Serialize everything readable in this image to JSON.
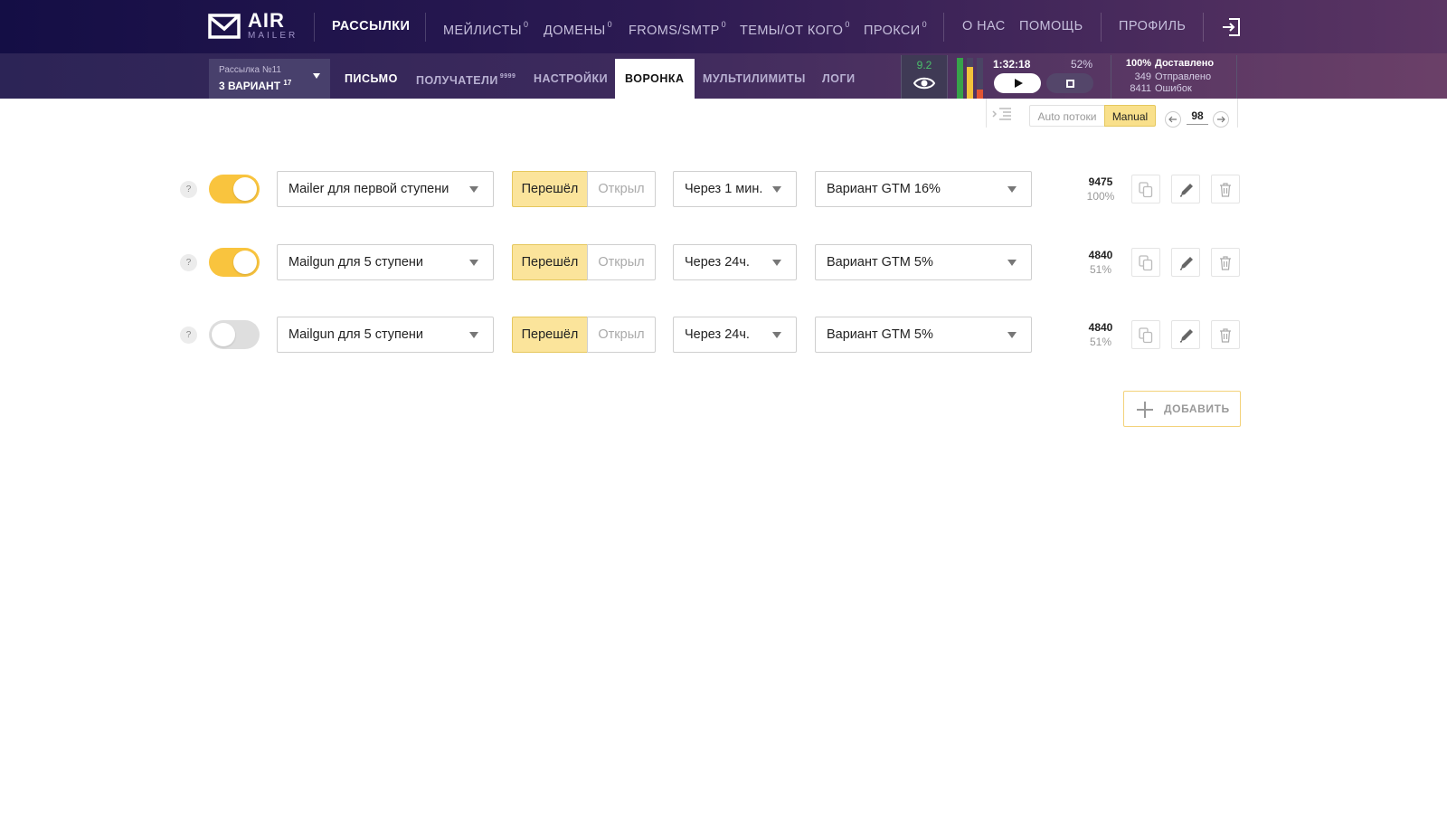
{
  "brand": {
    "name": "AIR",
    "sub": "MAILER"
  },
  "nav": {
    "items": [
      {
        "label": "Рассылки",
        "sup": ""
      },
      {
        "label": "Мейлисты",
        "sup": "0"
      },
      {
        "label": "Домены",
        "sup": "0"
      },
      {
        "label": "Froms/SMTP",
        "sup": "0"
      },
      {
        "label": "Темы/От кого",
        "sup": "0"
      },
      {
        "label": "Прокси",
        "sup": "0"
      },
      {
        "label": "О нас",
        "sup": ""
      },
      {
        "label": "Помощь",
        "sup": ""
      },
      {
        "label": "Профиль",
        "sup": ""
      }
    ],
    "logout_icon": "logout-icon"
  },
  "campaign": {
    "number": "Рассылка №11",
    "name": "3 Вариант",
    "sup": "17"
  },
  "tabs": [
    {
      "label": "Письмо",
      "sup": ""
    },
    {
      "label": "Получатели",
      "sup": "9999"
    },
    {
      "label": "Настройки",
      "sup": ""
    },
    {
      "label": "Воронка",
      "sup": ""
    },
    {
      "label": "Мультилимиты",
      "sup": ""
    },
    {
      "label": "Логи",
      "sup": ""
    }
  ],
  "score": "9.2",
  "timer": "1:32:18",
  "progress": "52%",
  "stats": [
    {
      "value": "100%",
      "label": "Доставлено"
    },
    {
      "value": "349",
      "label": "Отправлено"
    },
    {
      "value": "8411",
      "label": "Ошибок"
    }
  ],
  "toolbar": {
    "auto": "Auto потоки",
    "manual": "Manual",
    "page": "98"
  },
  "rows": [
    {
      "enabled": true,
      "sender": "Mailer для первой ступени",
      "seg_a": "Перешёл",
      "seg_b": "Открыл",
      "delay": "Через 1 мин.",
      "variant": "Вариант GTM 16%",
      "count": "9475",
      "percent": "100%"
    },
    {
      "enabled": true,
      "sender": "Mailgun для 5 ступени",
      "seg_a": "Перешёл",
      "seg_b": "Открыл",
      "delay": "Через 24ч.",
      "variant": "Вариант GTM 5%",
      "count": "4840",
      "percent": "51%"
    },
    {
      "enabled": false,
      "sender": "Mailgun для 5 ступени",
      "seg_a": "Перешёл",
      "seg_b": "Открыл",
      "delay": "Через 24ч.",
      "variant": "Вариант GTM 5%",
      "count": "4840",
      "percent": "51%"
    }
  ],
  "help_label": "?",
  "add_label": "Добавить",
  "colors": {
    "accent": "#f9c43e",
    "segment_active": "#fbe49b",
    "score_green": "#4bbf6b"
  }
}
